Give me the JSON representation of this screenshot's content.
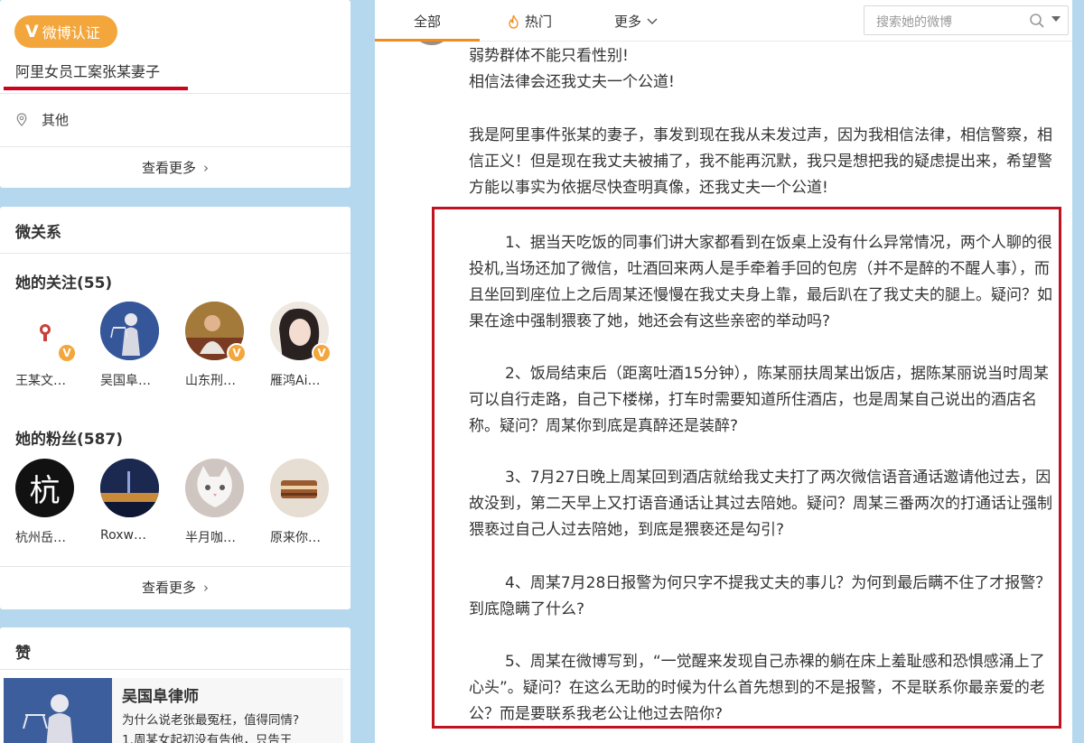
{
  "profile": {
    "verify_badge": "微博认证",
    "verify_title": "阿里女员工案张某妻子",
    "location": "其他",
    "see_more": "查看更多"
  },
  "relations": {
    "title": "微关系",
    "following_title": "她的关注(55)",
    "following": [
      {
        "name": "王某文…"
      },
      {
        "name": "吴国阜…"
      },
      {
        "name": "山东刑…"
      },
      {
        "name": "雁鸿Ai…"
      }
    ],
    "fans_title": "她的粉丝(587)",
    "fans": [
      {
        "name": "杭州岳…",
        "glyph": "杭"
      },
      {
        "name": "Roxw…"
      },
      {
        "name": "半月咖…"
      },
      {
        "name": "原来你…"
      }
    ],
    "see_more": "查看更多"
  },
  "likes": {
    "title": "赞",
    "item": {
      "title": "吴国阜律师",
      "desc_line1": "为什么说老张最冤枉，值得同情?",
      "desc_line2": "1.周某女起初没有告他，只告王"
    }
  },
  "tabs": {
    "all": "全部",
    "hot": "热门",
    "more": "更多",
    "search_placeholder": "搜索她的微博"
  },
  "post": {
    "line1": "弱势群体不能只看性别!",
    "line2": "相信法律会还我丈夫一个公道!",
    "intro": "我是阿里事件张某的妻子，事发到现在我从未发过声，因为我相信法律，相信警察，相信正义！但是现在我丈夫被捕了，我不能再沉默，我只是想把我的疑虑提出来，希望警方能以事实为依据尽快查明真像，还我丈夫一个公道!",
    "points": [
      "1、据当天吃饭的同事们讲大家都看到在饭桌上没有什么异常情况，两个人聊的很投机,当场还加了微信，吐酒回来两人是手牵着手回的包房（并不是醉的不醒人事），而且坐回到座位上之后周某还慢慢在我丈夫身上靠，最后趴在了我丈夫的腿上。疑问？如果在途中强制猥亵了她，她还会有这些亲密的举动吗?",
      "2、饭局结束后（距离吐酒15分钟），陈某丽扶周某出饭店，据陈某丽说当时周某可以自行走路，自己下楼梯，打车时需要知道所住酒店，也是周某自己说出的酒店名称。疑问？周某你到底是真醉还是装醉?",
      "3、7月27日晚上周某回到酒店就给我丈夫打了两次微信语音通话邀请他过去，因故没到，第二天早上又打语音通话让其过去陪她。疑问？周某三番两次的打通话让强制猥亵过自己人过去陪她，到底是猥亵还是勾引?",
      "4、周某7月28日报警为何只字不提我丈夫的事儿？为何到最后瞒不住了才报警？到底隐瞒了什么?",
      "5、周某在微博写到，“一觉醒来发现自己赤裸的躺在床上羞耻感和恐惧感涌上了心头”。疑问？在这么无助的时候为什么首先想到的不是报警，不是联系你最亲爱的老公？而是要联系我老公让他过去陪你?"
    ]
  },
  "colors": {
    "accent_orange": "#f28c1d",
    "verify_orange": "#f3a63b",
    "highlight_red": "#c1121f",
    "page_blue": "#b5d8ef"
  }
}
